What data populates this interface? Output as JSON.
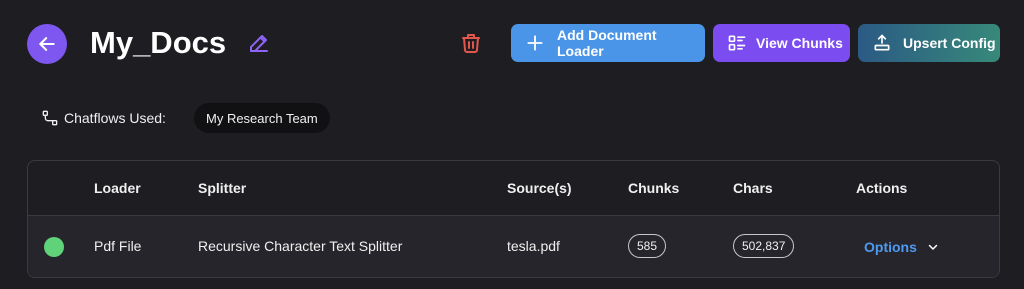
{
  "header": {
    "title": "My_Docs",
    "buttons": {
      "add_loader": "Add Document Loader",
      "view_chunks": "View Chunks",
      "upsert_config": "Upsert Config"
    }
  },
  "chatflows": {
    "label": "Chatflows Used:",
    "items": [
      "My Research Team"
    ]
  },
  "table": {
    "headers": {
      "loader": "Loader",
      "splitter": "Splitter",
      "sources": "Source(s)",
      "chunks": "Chunks",
      "chars": "Chars",
      "actions": "Actions"
    },
    "rows": [
      {
        "status": "active",
        "loader": "Pdf File",
        "splitter": "Recursive Character Text Splitter",
        "source": "tesla.pdf",
        "chunks": "585",
        "chars": "502,837",
        "action": "Options"
      }
    ]
  },
  "colors": {
    "accent_purple": "#7e57f0",
    "blue": "#4b95e8",
    "status_green": "#5fd27a",
    "delete_red": "#e2574c"
  }
}
